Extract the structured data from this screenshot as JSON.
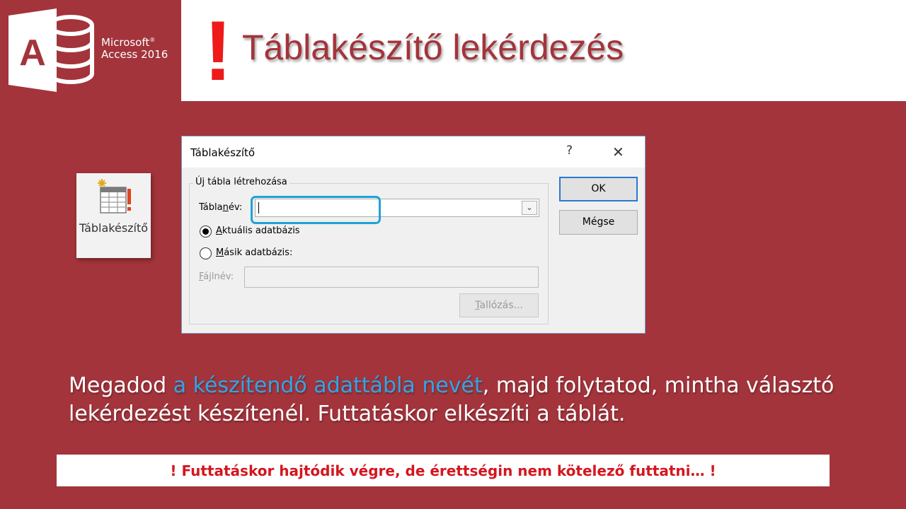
{
  "logo": {
    "icon": "access-icon",
    "brand": "Microsoft",
    "product": "Access 2016"
  },
  "header": {
    "exclamation": "!",
    "title": "Táblakészítő lekérdezés"
  },
  "ribbon_button": {
    "icon": "make-table-icon",
    "label": "Táblakészítő"
  },
  "dialog": {
    "title": "Táblakészítő",
    "help": "?",
    "close": "✕",
    "group_label": "Új tábla létrehozása",
    "table_name_label_pre": "Tábla",
    "table_name_label_ul": "n",
    "table_name_label_post": "év:",
    "table_name_value": "",
    "radio_current_ul": "A",
    "radio_current_rest": "ktuális adatbázis",
    "radio_current_checked": true,
    "radio_other_ul": "M",
    "radio_other_rest": "ásik adatbázis:",
    "radio_other_checked": false,
    "file_name_label_ul": "F",
    "file_name_label_rest": "ájlnév:",
    "file_name_value": "",
    "ok_label": "OK",
    "cancel_label": "Mégse",
    "browse_label_ul": "T",
    "browse_label_rest": "allózás..."
  },
  "description": {
    "part1": "Megadod ",
    "highlight": "a készítendő adattábla nevét",
    "part2": ", majd folytatod, mintha választó lekérdezést készítenél. Futtatáskor elkészíti a táblát."
  },
  "note": {
    "text": "! Futtatáskor hajtódik végre, de érettségin nem kötelező futtatni… !"
  },
  "colors": {
    "background": "#a3343b",
    "accent_blue": "#2ea6e8",
    "warning_red": "#d4161e",
    "exclamation_red": "#ee1a1a"
  }
}
